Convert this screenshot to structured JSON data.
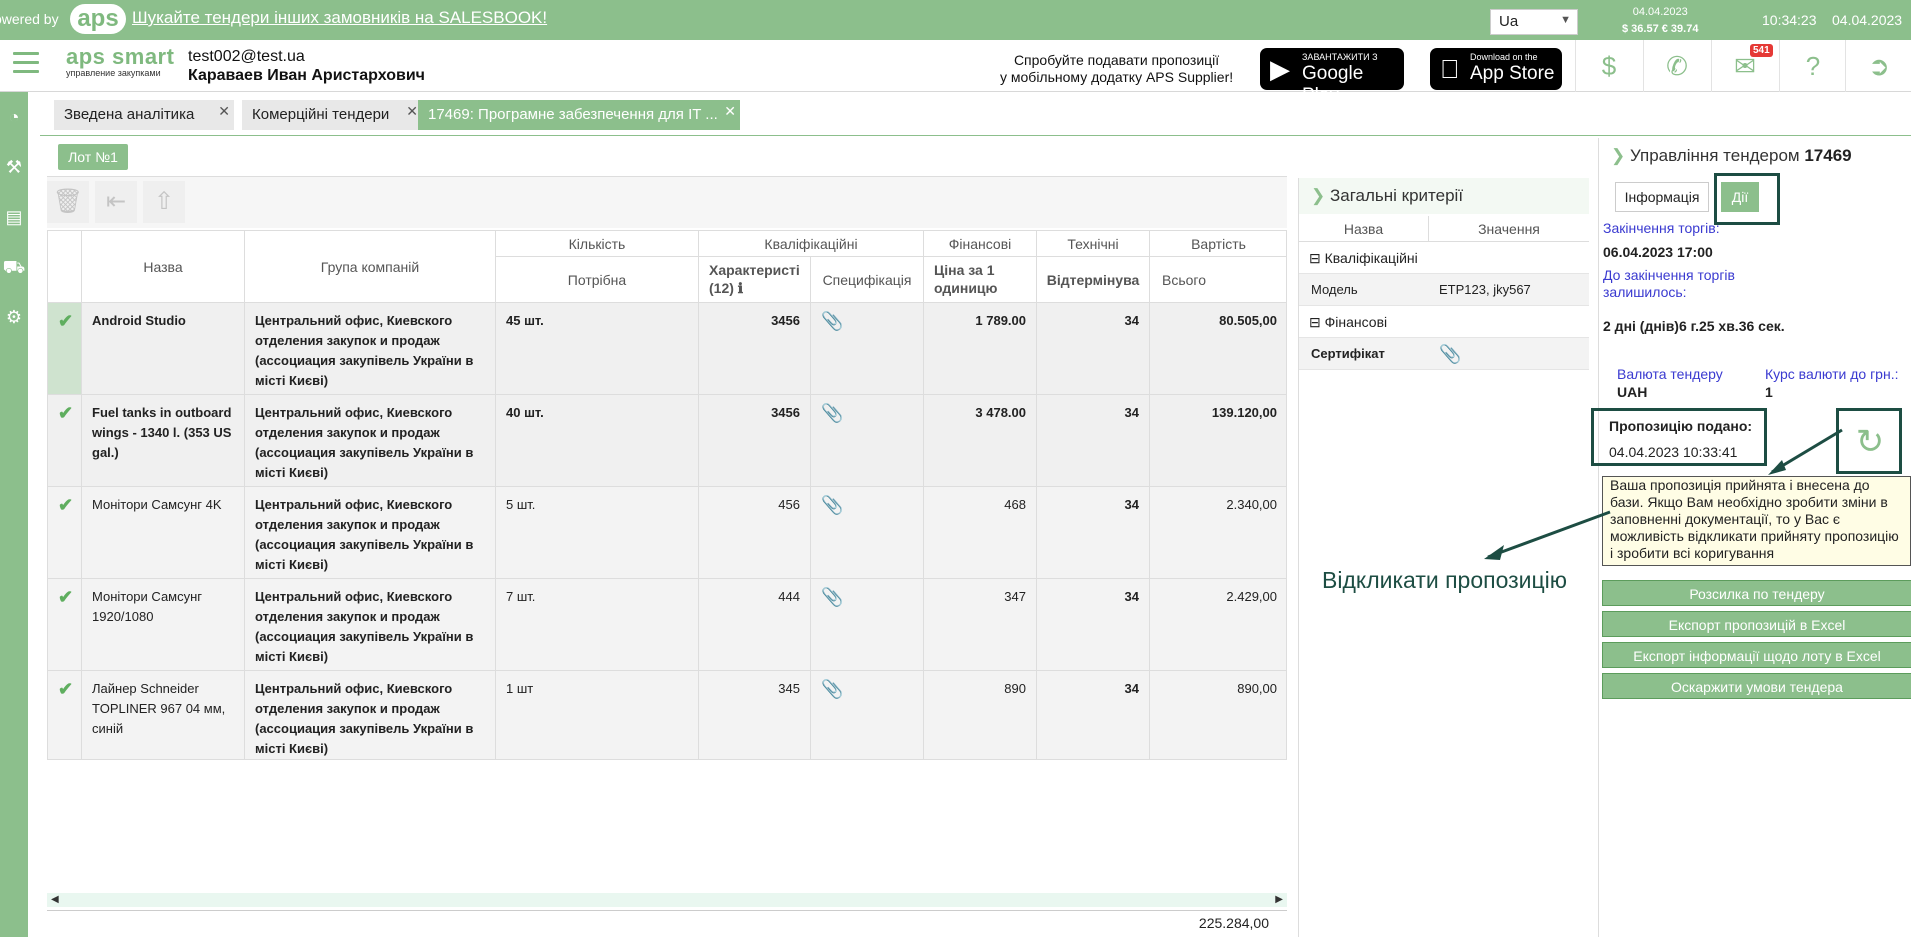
{
  "topbar": {
    "powered": "owered by",
    "logo": "aps",
    "promo": "Шукайте тендери інших замовників на SALESBOOK!",
    "lang": "Ua",
    "rates_date": "04.04.2023",
    "rates": "$ 36.57  € 39.74",
    "time": "10:34:23",
    "date": "04.04.2023"
  },
  "header": {
    "brand": "aps smart",
    "brand_sub": "управление закупками",
    "email": "test002@test.ua",
    "user_name": "Караваев Иван Аристархович",
    "mobile_line1": "Спробуйте подавати пропозиції",
    "mobile_line2": "у мобільному додатку APS Supplier!",
    "gplay_small": "ЗАВАНТАЖИТИ З",
    "gplay_big": "Google Play",
    "appstore_small": "Download on the",
    "appstore_big": "App Store",
    "mail_badge": "541"
  },
  "tabs": [
    {
      "label": "Зведена аналітика"
    },
    {
      "label": "Комерційні тендери"
    },
    {
      "label": "17469: Програмне забезпечення для IT ..."
    }
  ],
  "lot_button": "Лот №1",
  "grid": {
    "headers": {
      "name": "Назва",
      "group": "Група компаній",
      "quantity": "Кількість",
      "required": "Потрібна",
      "qualification": "Кваліфікаційні",
      "characteristics": "Характеристі (12)",
      "specification": "Специфікація",
      "financial": "Фінансові",
      "unit_price": "Ціна за 1 одиницю",
      "technical": "Технічні",
      "deferral": "Відтермінува",
      "cost": "Вартість",
      "total": "Всього"
    },
    "rows": [
      {
        "name": "Android Studio",
        "group": "Центральний офис, Киевского отделения закупок и продаж (ассоциация закупівель України в місті Києві)",
        "qty": "45 шт.",
        "char": "3456",
        "price": "1 789.00",
        "tech": "34",
        "total": "80.505,00",
        "bold": true
      },
      {
        "name": "Fuel tanks in outboard wings - 1340 l. (353 US gal.)",
        "group": "Центральний офис, Киевского отделения закупок и продаж (ассоциация закупівель України в місті Києві)",
        "qty": "40 шт.",
        "char": "3456",
        "price": "3 478.00",
        "tech": "34",
        "total": "139.120,00",
        "bold": true
      },
      {
        "name": "Монітори Самсунг 4K",
        "group": "Центральний офис, Киевского отделения закупок и продаж (ассоциация закупівель України в місті Києві)",
        "qty": "5 шт.",
        "char": "456",
        "price": "468",
        "tech": "34",
        "total": "2.340,00",
        "bold": false
      },
      {
        "name": "Монітори Самсунг 1920/1080",
        "group": "Центральний офис, Киевского отделения закупок и продаж (ассоциация закупівель України в місті Києві)",
        "qty": "7 шт.",
        "char": "444",
        "price": "347",
        "tech": "34",
        "total": "2.429,00",
        "bold": false
      },
      {
        "name": "Лайнер Schneider TOPLINER 967 04 мм, синій",
        "group": "Центральний офис, Киевского отделения закупок и продаж (ассоциация закупівель України в місті Києві)",
        "qty": "1 шт",
        "char": "345",
        "price": "890",
        "tech": "34",
        "total": "890,00",
        "bold": false
      }
    ],
    "grand_total": "225.284,00"
  },
  "criteria": {
    "title": "Загальні критерії",
    "col_name": "Назва",
    "col_value": "Значення",
    "group1": "Кваліфікаційні",
    "row1_name": "Модель",
    "row1_value": "ETP123, jky567",
    "group2": "Фінансові",
    "row2_name": "Сертифікат"
  },
  "management": {
    "title": "Управління тендером",
    "tender_no": "17469",
    "tab_info": "Інформація",
    "tab_actions": "Дії",
    "end_label": "Закінчення торгів:",
    "end_value": "06.04.2023 17:00",
    "remain_label": "До закінчення торгів залишилось:",
    "remain_value": "2 дні (днів)6 г.25 хв.36 сек.",
    "currency_label": "Валюта тендеру",
    "currency_value": "UAH",
    "rate_label": "Курс валюти до грн.:",
    "rate_value": "1",
    "submitted_label": "Пропозицію подано:",
    "submitted_value": "04.04.2023 10:33:41",
    "tooltip": "Ваша пропозиція прийнята і внесена до бази. Якщо Вам необхідно зробити зміни в заповненні документації, то у Вас є можливість відкликати прийняту пропозицію і зробити всі коригування",
    "annotation": "Відкликати пропозицію",
    "buttons": [
      "Розсилка по тендеру",
      "Експорт пропозицій в Excel",
      "Експорт інформації щодо лоту в Excel",
      "Оскаржити умови тендера"
    ]
  }
}
